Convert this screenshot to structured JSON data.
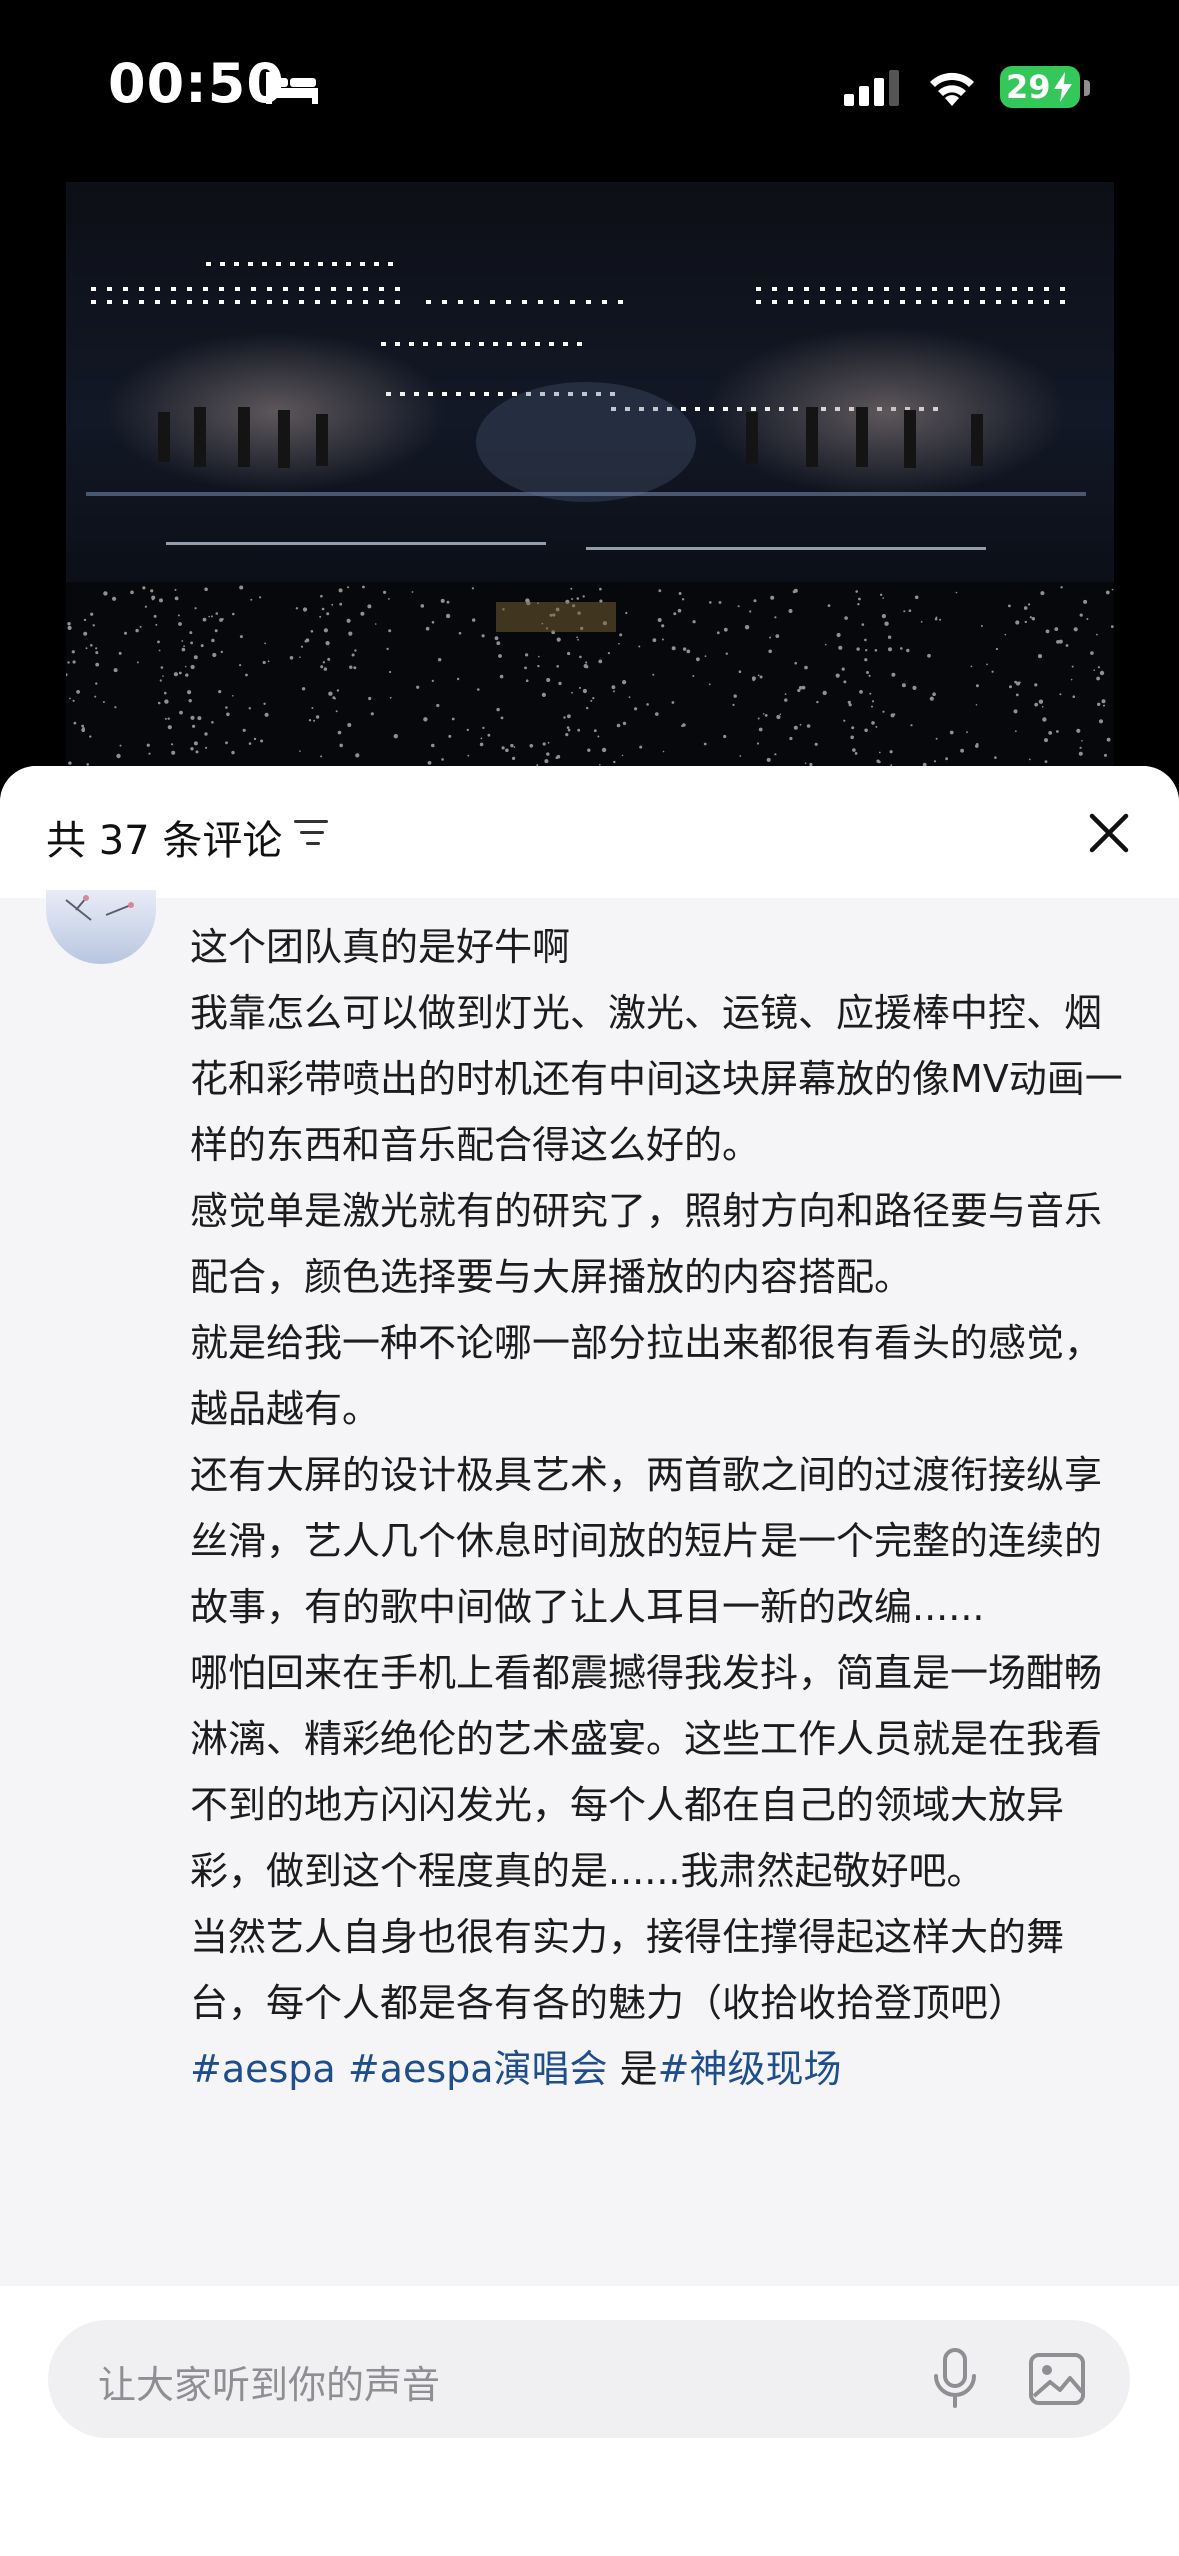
{
  "status_bar": {
    "time": "00:50",
    "battery": "29",
    "icons": [
      "bed-icon",
      "signal-icon",
      "wifi-icon",
      "battery-icon"
    ]
  },
  "video": {
    "description_icon": "concert-stage"
  },
  "comments": {
    "count_label": "共 37 条评论",
    "filter_icon": "filter-icon",
    "close_icon": "close-icon",
    "paragraphs": [
      "这个团队真的是好牛啊",
      "我靠怎么可以做到灯光、激光、运镜、应援棒中控、烟花和彩带喷出的时机还有中间这块屏幕放的像MV动画一样的东西和音乐配合得这么好的。",
      "感觉单是激光就有的研究了，照射方向和路径要与音乐配合，颜色选择要与大屏播放的内容搭配。",
      "就是给我一种不论哪一部分拉出来都很有看头的感觉，越品越有。",
      "还有大屏的设计极具艺术，两首歌之间的过渡衔接纵享丝滑，艺人几个休息时间放的短片是一个完整的连续的故事，有的歌中间做了让人耳目一新的改编......",
      "哪怕回来在手机上看都震撼得我发抖，简直是一场酣畅淋漓、精彩绝伦的艺术盛宴。这些工作人员就是在我看不到的地方闪闪发光，每个人都在自己的领域大放异彩，做到这个程度真的是......我肃然起敬好吧。",
      "当然艺人自身也很有实力，接得住撑得起这样大的舞台，每个人都是各有各的魅力（收拾收拾登顶吧）"
    ],
    "hashtags": {
      "tag1": "#aespa",
      "tag2": "#aespa演唱会",
      "connector": "是",
      "tag3": "#神级现场"
    }
  },
  "input": {
    "placeholder": "让大家听到你的声音",
    "mic_icon": "mic-icon",
    "image_icon": "image-icon"
  },
  "colors": {
    "hashtag": "#1f4e8c",
    "battery": "#34c759",
    "sheet_bg": "#f5f5f7"
  }
}
